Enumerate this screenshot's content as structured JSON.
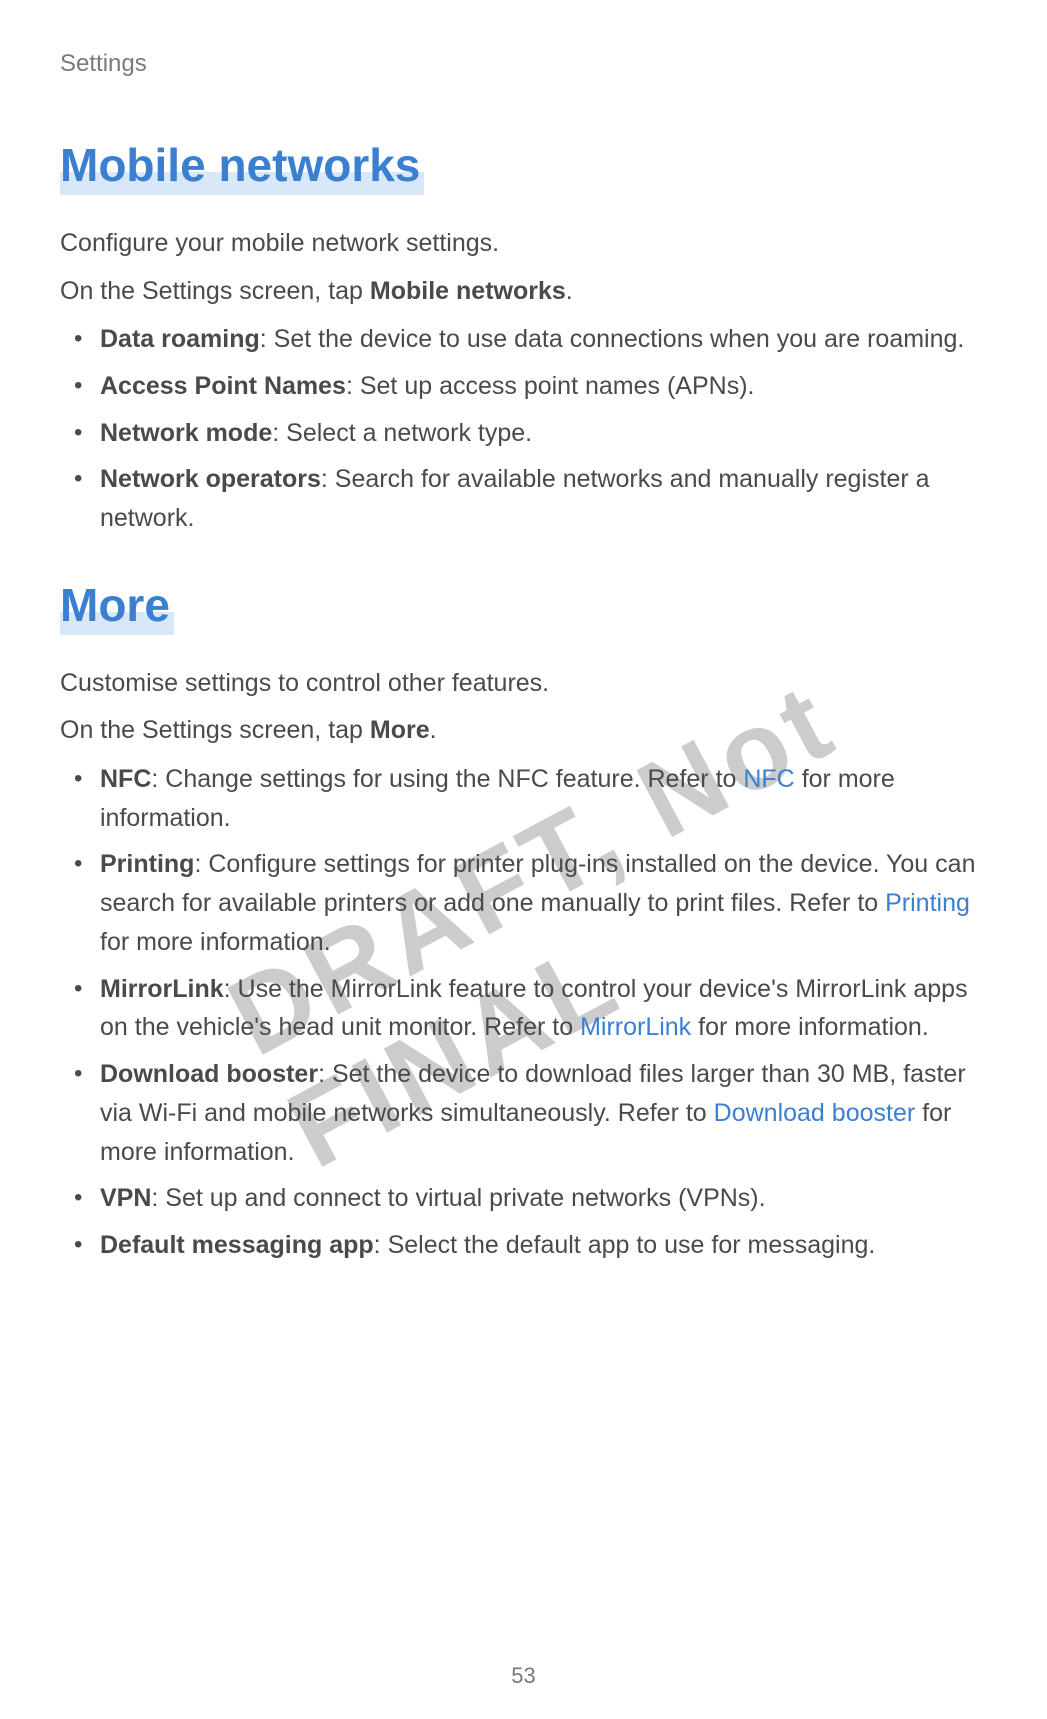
{
  "header": {
    "title": "Settings"
  },
  "watermark": "DRAFT, Not FINAL",
  "sections": {
    "mobile_networks": {
      "title": "Mobile networks",
      "intro": "Configure your mobile network settings.",
      "instruction_prefix": "On the Settings screen, tap ",
      "instruction_target": "Mobile networks",
      "instruction_suffix": ".",
      "items": [
        {
          "label": "Data roaming",
          "desc": ": Set the device to use data connections when you are roaming."
        },
        {
          "label": "Access Point Names",
          "desc": ": Set up access point names (APNs)."
        },
        {
          "label": "Network mode",
          "desc": ": Select a network type."
        },
        {
          "label": "Network operators",
          "desc": ": Search for available networks and manually register a network."
        }
      ]
    },
    "more": {
      "title": "More",
      "intro": "Customise settings to control other features.",
      "instruction_prefix": "On the Settings screen, tap ",
      "instruction_target": "More",
      "instruction_suffix": ".",
      "items": [
        {
          "label": "NFC",
          "desc_before": ": Change settings for using the NFC feature. Refer to ",
          "link": "NFC",
          "desc_after": " for more information."
        },
        {
          "label": "Printing",
          "desc_before": ": Configure settings for printer plug-ins installed on the device. You can search for available printers or add one manually to print files. Refer to ",
          "link": "Printing",
          "desc_after": " for more information."
        },
        {
          "label": "MirrorLink",
          "desc_before": ": Use the MirrorLink feature to control your device's MirrorLink apps on the vehicle's head unit monitor. Refer to ",
          "link": "MirrorLink",
          "desc_after": " for more information."
        },
        {
          "label": "Download booster",
          "desc_before": ": Set the device to download files larger than 30 MB, faster via Wi-Fi and mobile networks simultaneously. Refer to ",
          "link": "Download booster",
          "desc_after": " for more information."
        },
        {
          "label": "VPN",
          "desc_plain": ": Set up and connect to virtual private networks (VPNs)."
        },
        {
          "label": "Default messaging app",
          "desc_plain": ": Select the default app to use for messaging."
        }
      ]
    }
  },
  "page_number": "53"
}
